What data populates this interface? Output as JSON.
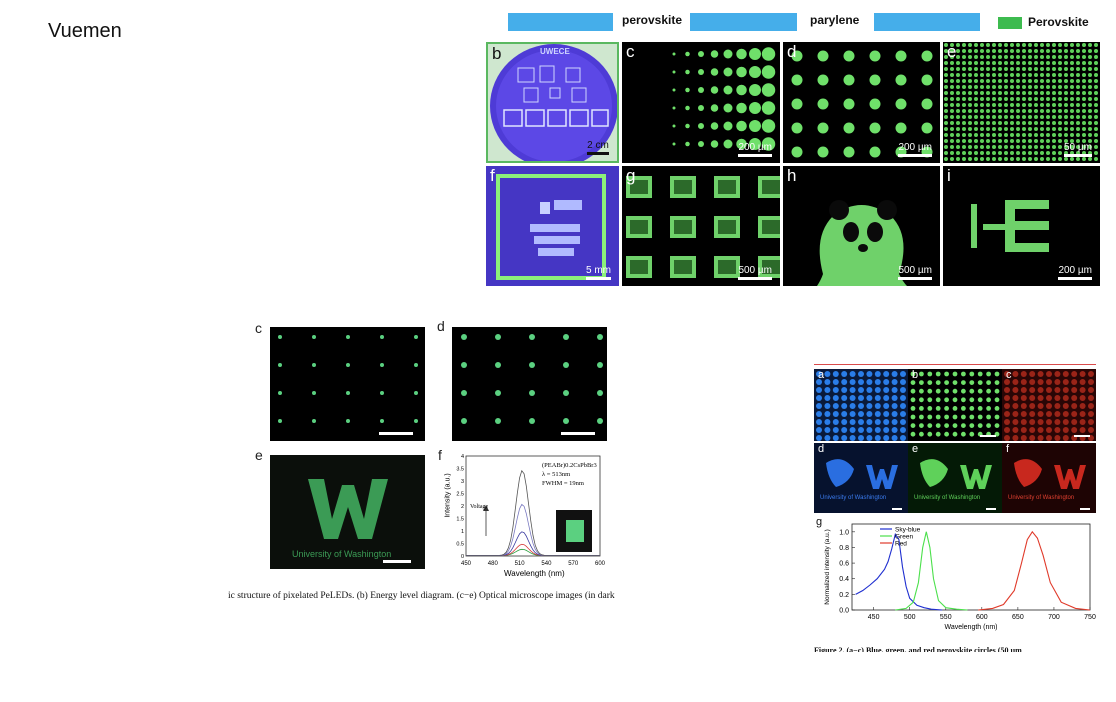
{
  "brand": "Vuemen",
  "legend": {
    "perovskite": "perovskite",
    "parylene": "parylene",
    "swatch_label": "Perovskite",
    "swatch_color": "#3dbb4f",
    "strip_color": "#45aeea"
  },
  "figA": {
    "panels": [
      {
        "label": "b",
        "scale": "2 cm",
        "wafer_text": "UWECE"
      },
      {
        "label": "c",
        "scale": "200 µm"
      },
      {
        "label": "d",
        "scale": "200 µm"
      },
      {
        "label": "e",
        "scale": "50 µm"
      },
      {
        "label": "f",
        "scale": "5 mm"
      },
      {
        "label": "g",
        "scale": "500 µm"
      },
      {
        "label": "h",
        "scale": "500 µm"
      },
      {
        "label": "i",
        "scale": "200 µm"
      }
    ]
  },
  "figB": {
    "labels": {
      "c": "c",
      "d": "d",
      "e": "e",
      "f": "f"
    },
    "uw_text": "University of Washington",
    "caption": "ic structure of pixelated PeLEDs. (b) Energy level diagram. (c−e) Optical microscope images (in dark",
    "spectrum": {
      "ylabel": "Intensity (a.u.)",
      "xlabel": "Wavelength (nm)",
      "xticks": [
        "450",
        "480",
        "510",
        "540",
        "570",
        "600"
      ],
      "yticks": [
        "0",
        "0.5",
        "1",
        "1.5",
        "2",
        "2.5",
        "3",
        "3.5",
        "4"
      ],
      "annotation": [
        "(PEABr)0.2CsPbBr3",
        "λ = 513nm",
        "FWHM = 19nm"
      ],
      "arrow_label": "Voltage"
    }
  },
  "figC": {
    "labels": {
      "a": "a",
      "b": "b",
      "c": "c",
      "d": "d",
      "e": "e",
      "f": "f",
      "g": "g"
    },
    "uw_text": "University of Washington",
    "caption": "Figure 2. (a−c) Blue, green, and red perovskite circles (50 µm",
    "chart_data": {
      "type": "line",
      "xlabel": "Wavelength (nm)",
      "ylabel": "Normalized intensity (a.u.)",
      "xlim": [
        420,
        750
      ],
      "ylim": [
        0,
        1.1
      ],
      "xticks": [
        450,
        500,
        550,
        600,
        650,
        700,
        750
      ],
      "yticks": [
        0.0,
        0.2,
        0.4,
        0.6,
        0.8,
        1.0
      ],
      "legend_position": "top-left",
      "series": [
        {
          "name": "Sky-blue",
          "color": "#1f2fd0",
          "x": [
            425,
            435,
            445,
            455,
            465,
            470,
            475,
            480,
            485,
            490,
            495,
            500,
            510,
            520,
            530,
            545
          ],
          "y": [
            0.2,
            0.25,
            0.32,
            0.4,
            0.52,
            0.62,
            0.78,
            0.97,
            0.9,
            0.55,
            0.3,
            0.15,
            0.06,
            0.03,
            0.01,
            0.0
          ]
        },
        {
          "name": "Green",
          "color": "#4be04b",
          "x": [
            480,
            495,
            505,
            512,
            518,
            523,
            528,
            533,
            540,
            550,
            565,
            580
          ],
          "y": [
            0.0,
            0.02,
            0.1,
            0.35,
            0.8,
            1.0,
            0.8,
            0.4,
            0.12,
            0.03,
            0.01,
            0.0
          ]
        },
        {
          "name": "Red",
          "color": "#e03a2a",
          "x": [
            595,
            615,
            630,
            645,
            655,
            663,
            670,
            677,
            685,
            695,
            710,
            730,
            750
          ],
          "y": [
            0.0,
            0.02,
            0.07,
            0.25,
            0.6,
            0.9,
            1.0,
            0.92,
            0.7,
            0.35,
            0.1,
            0.02,
            0.0
          ]
        }
      ]
    }
  }
}
